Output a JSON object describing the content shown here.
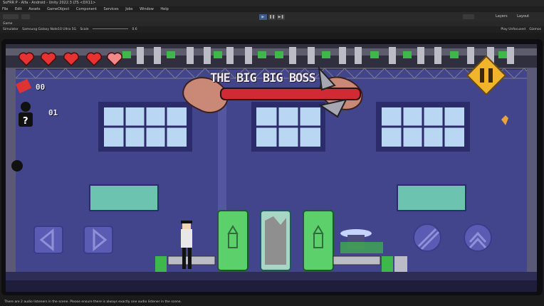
{
  "app": {
    "title": "SoFRR P - Alfa - Android - Unity 2022.3 LTS <DX11>"
  },
  "menu": [
    "File",
    "Edit",
    "Assets",
    "GameObject",
    "Component",
    "Services",
    "Jobs",
    "Window",
    "Help"
  ],
  "toolbar": {
    "layers_label": "Layers",
    "layout_label": "Layout"
  },
  "tabs": {
    "game_tab": "Game"
  },
  "game_toolbar": {
    "display": "Simulator",
    "device": "Samsung Galaxy Note10 Ultra 5G",
    "scale_label": "Scale",
    "scale_value": "0.6",
    "right_label": "Play Unfocused",
    "gizmos": "Gizmos"
  },
  "hud": {
    "boss_name": "THE BIG BIG BOSS",
    "ammo_count": "00",
    "item_count": "01",
    "hearts": 5
  },
  "status": {
    "message": "There are 2 audio listeners in the scene. Please ensure there is always exactly one audio listener in the scene."
  },
  "colors": {
    "wall": "#43458c",
    "pipe_top": "#3a3a48",
    "window_frame": "#2c2c6a",
    "window_glass": "#b9d6f2",
    "tube_green": "#5cd06a",
    "heart": "#e53232",
    "pause_bg": "#f0b52a",
    "floor": "#2d2d55"
  }
}
